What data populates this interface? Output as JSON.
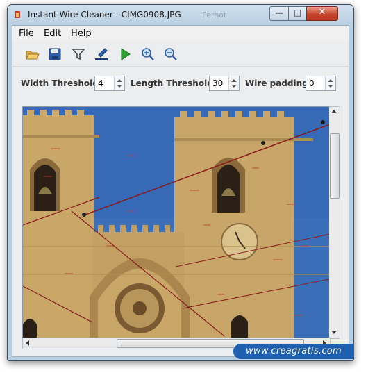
{
  "window": {
    "title": "Instant Wire Cleaner - CIMG0908.JPG",
    "background_title": "Pernot",
    "controls": {
      "minimize": "—",
      "maximize": "□",
      "close": "✕"
    }
  },
  "menu": [
    "File",
    "Edit",
    "Help"
  ],
  "toolbar": {
    "icons": [
      "open-folder-icon",
      "save-icon",
      "filter-icon",
      "brush-icon",
      "play-icon",
      "zoom-in-icon",
      "zoom-out-icon"
    ]
  },
  "params": {
    "width_threshold": {
      "label": "Width Threshold",
      "value": "4"
    },
    "length_threshold": {
      "label": "Length Threshold",
      "value": "30"
    },
    "wire_padding": {
      "label": "Wire padding",
      "value": "0"
    }
  },
  "image": {
    "subject": "cathedral-facade-photo",
    "sky_color": "#3a6fb8",
    "stone_color": "#c9a769",
    "wire_color": "#8a1a1a"
  },
  "watermark": "www.creagratis.com"
}
